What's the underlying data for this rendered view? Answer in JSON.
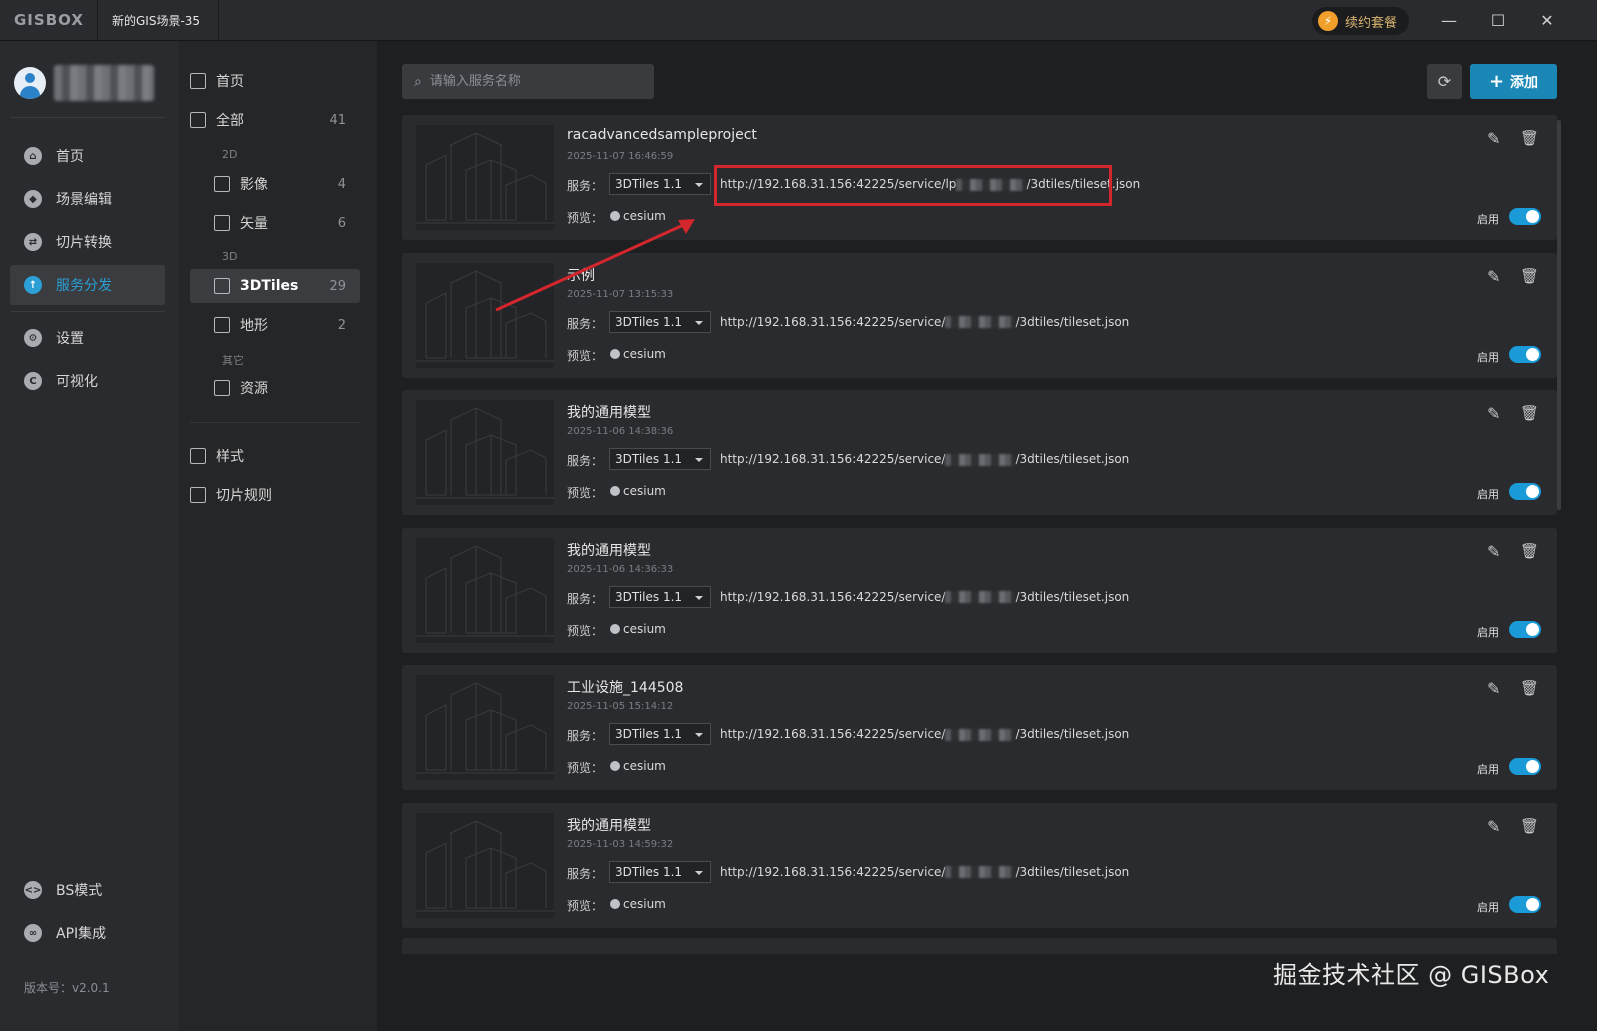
{
  "titlebar": {
    "logo": "GISBOX",
    "doc_tab": "新的GIS场景-35",
    "renew_label": "续约套餐",
    "minimize": "—",
    "maximize": "☐",
    "close": "✕"
  },
  "sidebar": {
    "items": [
      {
        "label": "首页",
        "icon": "home-icon",
        "glyph": "⌂"
      },
      {
        "label": "场景编辑",
        "icon": "cube-icon",
        "glyph": "◆"
      },
      {
        "label": "切片转换",
        "icon": "exchange-icon",
        "glyph": "⇄"
      },
      {
        "label": "服务分发",
        "icon": "upload-icon",
        "glyph": "↑",
        "active": true
      },
      {
        "label": "设置",
        "icon": "gear-icon",
        "glyph": "⚙"
      },
      {
        "label": "可视化",
        "icon": "chart-icon",
        "glyph": "C"
      }
    ],
    "bottom_items": [
      {
        "label": "BS模式",
        "icon": "code-icon",
        "glyph": "<>"
      },
      {
        "label": "API集成",
        "icon": "link-icon",
        "glyph": "∞"
      }
    ],
    "version": "版本号：v2.0.1"
  },
  "categories": {
    "home": "首页",
    "all": {
      "label": "全部",
      "count": "41"
    },
    "sec_2d": "2D",
    "imagery": {
      "label": "影像",
      "count": "4"
    },
    "vector": {
      "label": "矢量",
      "count": "6"
    },
    "sec_3d": "3D",
    "tiles3d": {
      "label": "3DTiles",
      "count": "29"
    },
    "terrain": {
      "label": "地形",
      "count": "2"
    },
    "sec_other": "其它",
    "resource": "资源",
    "style": "样式",
    "tile_rules": "切片规则"
  },
  "toolbar": {
    "search_placeholder": "请输入服务名称",
    "add_label": "添加"
  },
  "labels": {
    "service": "服务：",
    "preview": "预览：",
    "enabled": "启用",
    "cesium": "cesium"
  },
  "services": [
    {
      "title": "racadvancedsampleproject",
      "date": "2025-11-07 16:46:59",
      "type": "3DTiles 1.1",
      "url_prefix": "http://192.168.31.156:42225/service/lp",
      "url_suffix": "/3dtiles/tileset.json"
    },
    {
      "title": "示例",
      "date": "2025-11-07 13:15:33",
      "type": "3DTiles 1.1",
      "url_prefix": "http://192.168.31.156:42225/service/",
      "url_suffix": "/3dtiles/tileset.json"
    },
    {
      "title": "我的通用模型",
      "date": "2025-11-06 14:38:36",
      "type": "3DTiles 1.1",
      "url_prefix": "http://192.168.31.156:42225/service/",
      "url_suffix": "/3dtiles/tileset.json"
    },
    {
      "title": "我的通用模型",
      "date": "2025-11-06 14:36:33",
      "type": "3DTiles 1.1",
      "url_prefix": "http://192.168.31.156:42225/service/",
      "url_suffix": "/3dtiles/tileset.json"
    },
    {
      "title": "工业设施_144508",
      "date": "2025-11-05 15:14:12",
      "type": "3DTiles 1.1",
      "url_prefix": "http://192.168.31.156:42225/service/",
      "url_suffix": "/3dtiles/tileset.json"
    },
    {
      "title": "我的通用模型",
      "date": "2025-11-03 14:59:32",
      "type": "3DTiles 1.1",
      "url_prefix": "http://192.168.31.156:42225/service/",
      "url_suffix": "/3dtiles/tileset.json"
    }
  ],
  "watermark": "掘金技术社区 @ GISBox"
}
